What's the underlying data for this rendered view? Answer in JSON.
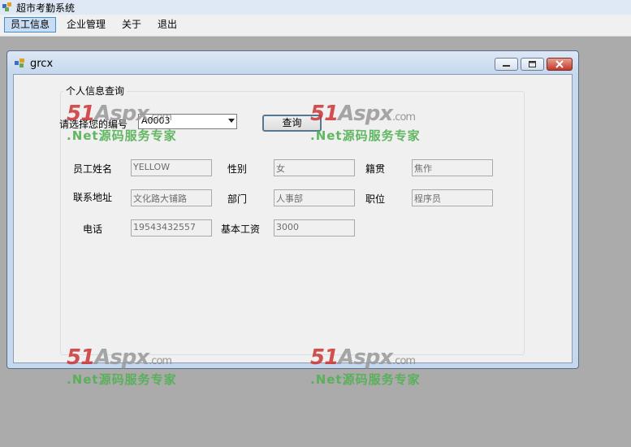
{
  "app": {
    "title": "超市考勤系统"
  },
  "menu": {
    "items": [
      "员工信息",
      "企业管理",
      "关于",
      "退出"
    ]
  },
  "child_window": {
    "title": "grcx"
  },
  "form": {
    "group_title": "个人信息查询",
    "select_label": "请选择您的编号",
    "employee_id": "A0003",
    "query_button": "查询",
    "fields": {
      "name_label": "员工姓名",
      "name_value": "YELLOW",
      "gender_label": "性别",
      "gender_value": "女",
      "hometown_label": "籍贯",
      "hometown_value": "焦作",
      "address_label": "联系地址",
      "address_value": "文化路大铺路",
      "dept_label": "部门",
      "dept_value": "人事部",
      "position_label": "职位",
      "position_value": "程序员",
      "phone_label": "电话",
      "phone_value": "19543432557",
      "salary_label": "基本工资",
      "salary_value": "3000"
    }
  },
  "watermark": {
    "logo_main": "51",
    "logo_aspx": "Aspx",
    "logo_com": ".com",
    "tagline": ".Net源码服务专家"
  },
  "colors": {
    "background": "#ababab",
    "menubar": "#f0f0f0",
    "watermark_red": "#cc3333",
    "watermark_green": "#52b152"
  }
}
